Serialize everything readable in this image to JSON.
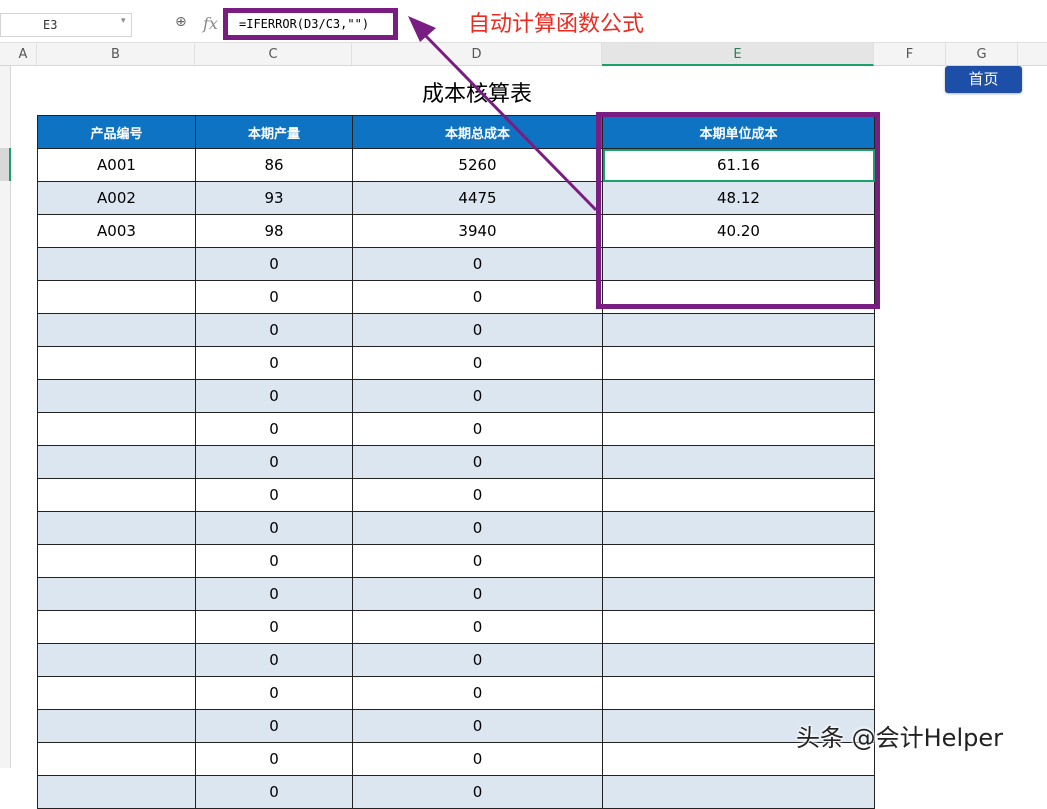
{
  "formula_bar": {
    "cell_ref": "E3",
    "formula": "=IFERROR(D3/C3,\"\")",
    "annotation": "自动计算函数公式"
  },
  "columns": [
    "A",
    "B",
    "C",
    "D",
    "E",
    "F",
    "G"
  ],
  "sheet": {
    "title": "成本核算表",
    "home_button": "首页"
  },
  "table": {
    "headers": [
      "产品编号",
      "本期产量",
      "本期总成本",
      "本期单位成本"
    ],
    "rows": [
      {
        "code": "A001",
        "qty": "86",
        "total": "5260",
        "unit": "61.16"
      },
      {
        "code": "A002",
        "qty": "93",
        "total": "4475",
        "unit": "48.12"
      },
      {
        "code": "A003",
        "qty": "98",
        "total": "3940",
        "unit": "40.20"
      },
      {
        "code": "",
        "qty": "0",
        "total": "0",
        "unit": ""
      },
      {
        "code": "",
        "qty": "0",
        "total": "0",
        "unit": ""
      },
      {
        "code": "",
        "qty": "0",
        "total": "0",
        "unit": ""
      },
      {
        "code": "",
        "qty": "0",
        "total": "0",
        "unit": ""
      },
      {
        "code": "",
        "qty": "0",
        "total": "0",
        "unit": ""
      },
      {
        "code": "",
        "qty": "0",
        "total": "0",
        "unit": ""
      },
      {
        "code": "",
        "qty": "0",
        "total": "0",
        "unit": ""
      },
      {
        "code": "",
        "qty": "0",
        "total": "0",
        "unit": ""
      },
      {
        "code": "",
        "qty": "0",
        "total": "0",
        "unit": ""
      },
      {
        "code": "",
        "qty": "0",
        "total": "0",
        "unit": ""
      },
      {
        "code": "",
        "qty": "0",
        "total": "0",
        "unit": ""
      },
      {
        "code": "",
        "qty": "0",
        "total": "0",
        "unit": ""
      },
      {
        "code": "",
        "qty": "0",
        "total": "0",
        "unit": ""
      },
      {
        "code": "",
        "qty": "0",
        "total": "0",
        "unit": ""
      },
      {
        "code": "",
        "qty": "0",
        "total": "0",
        "unit": ""
      },
      {
        "code": "",
        "qty": "0",
        "total": "0",
        "unit": ""
      },
      {
        "code": "",
        "qty": "0",
        "total": "0",
        "unit": ""
      }
    ]
  },
  "watermark": "头条 @会计Helper",
  "icons": {
    "zoom": "zoom-icon",
    "fx": "fx-icon",
    "dropdown": "chevron-down-icon"
  },
  "colors": {
    "header_blue": "#0e73c2",
    "highlight_purple": "#7a1d82",
    "annotation_red": "#ee2a20",
    "band": "#dce6f1"
  }
}
